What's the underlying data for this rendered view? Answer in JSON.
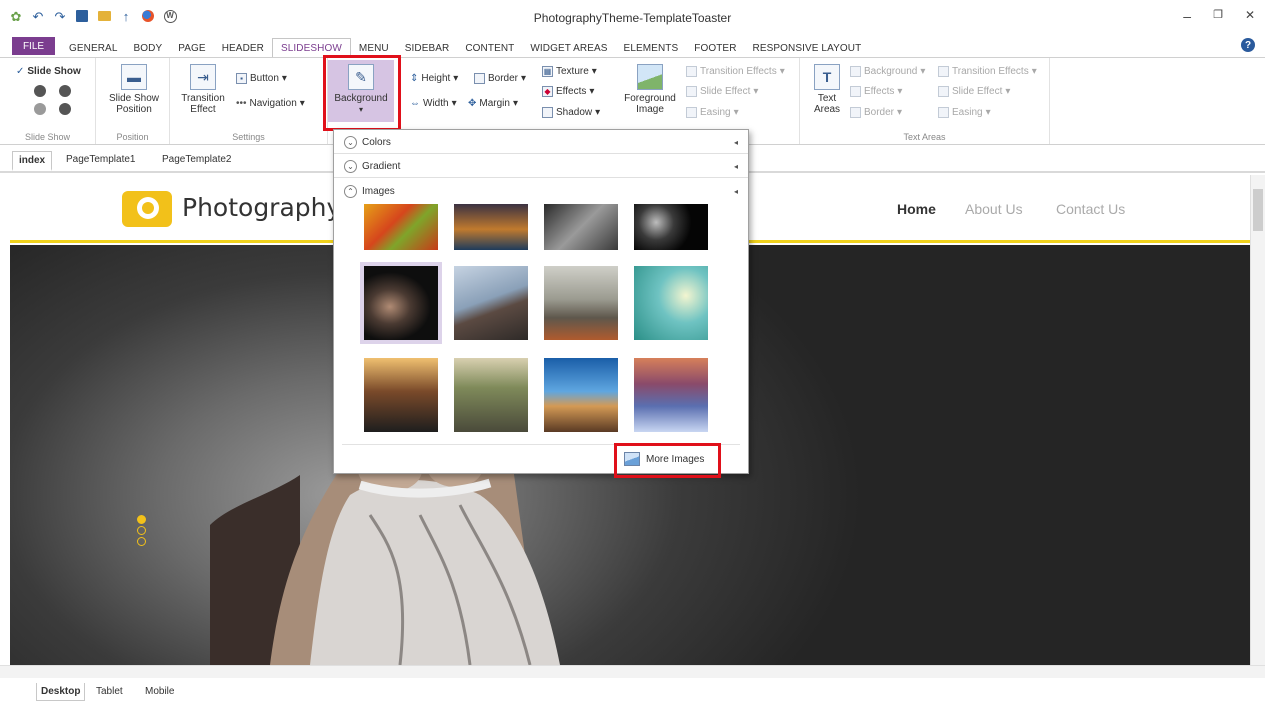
{
  "app": {
    "title": "PhotographyTheme-TemplateToaster"
  },
  "qat": {
    "icons": [
      "app-logo-icon",
      "undo-icon",
      "redo-icon",
      "save-icon",
      "open-folder-icon",
      "publish-icon",
      "browser-icon",
      "wordpress-icon"
    ]
  },
  "window": {
    "minimize": "–",
    "restore": "❐",
    "close": "✕"
  },
  "tabs": {
    "file": "FILE",
    "items": [
      "GENERAL",
      "BODY",
      "PAGE",
      "HEADER",
      "SLIDESHOW",
      "MENU",
      "SIDEBAR",
      "CONTENT",
      "WIDGET AREAS",
      "ELEMENTS",
      "FOOTER",
      "RESPONSIVE LAYOUT"
    ],
    "active": "SLIDESHOW"
  },
  "ribbon": {
    "slideshow_group": {
      "checkbox_label": "Slide Show",
      "checked": true,
      "label": "Slide Show"
    },
    "position_group": {
      "button": "Slide Show\nPosition",
      "label": "Position"
    },
    "settings_group": {
      "transition_effect": "Transition\nEffect",
      "button": "Button",
      "navigation": "Navigation",
      "label": "Settings"
    },
    "background_btn": "Background",
    "size": {
      "height": "Height",
      "width": "Width",
      "border": "Border",
      "margin": "Margin"
    },
    "style": {
      "texture": "Texture",
      "effects": "Effects",
      "shadow": "Shadow"
    },
    "foreground": {
      "button": "Foreground\nImage",
      "transition_effects": "Transition Effects",
      "slide_effect": "Slide Effect",
      "easing": "Easing"
    },
    "text_areas_group": {
      "button": "Text\nAreas",
      "background": "Background",
      "effects": "Effects",
      "border": "Border",
      "transition_effects": "Transition Effects",
      "slide_effect": "Slide Effect",
      "easing": "Easing",
      "label": "Text Areas"
    }
  },
  "page_tabs": [
    "index",
    "PageTemplate1",
    "PageTemplate2"
  ],
  "page_tabs_active": "index",
  "site": {
    "title": "Photography",
    "nav": [
      "Home",
      "About Us",
      "Contact Us"
    ],
    "nav_active": "Home",
    "accent": "#f2c11a"
  },
  "dropdown": {
    "sections": [
      {
        "label": "Colors",
        "expanded": false
      },
      {
        "label": "Gradient",
        "expanded": false
      },
      {
        "label": "Images",
        "expanded": true
      }
    ],
    "thumbnails": [
      "autumn-leaves",
      "city-night",
      "hands-phone",
      "dark-portrait",
      "woman-fur-dark",
      "photographer-mountains",
      "bridge-river",
      "balloon-sky",
      "car-road",
      "traveler-road",
      "road-horizon",
      "city-lights"
    ],
    "selected_thumbnail": 4,
    "more_images": "More Images"
  },
  "device_tabs": [
    "Desktop",
    "Tablet",
    "Mobile"
  ],
  "device_tabs_active": "Desktop",
  "slide": {
    "dots": 3,
    "active_dot": 0
  },
  "colors": {
    "highlight_red": "#e0101a",
    "file_tab": "#7b3d8f",
    "header_border": "#f0d21d"
  }
}
